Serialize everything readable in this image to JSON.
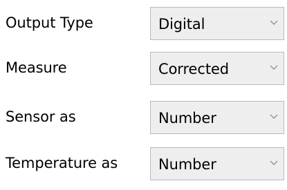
{
  "form": {
    "rows": [
      {
        "label": "Output Type",
        "value": "Digital"
      },
      {
        "label": "Measure",
        "value": "Corrected"
      },
      {
        "label": "Sensor as",
        "value": "Number"
      },
      {
        "label": "Temperature as",
        "value": "Number"
      }
    ]
  },
  "icons": {
    "dropdown": "chevron-down-icon"
  },
  "colors": {
    "dropdown_background": "#eeeeee",
    "dropdown_border": "#b9b9b9",
    "chevron": "#8a8a8a",
    "text": "#000000"
  }
}
